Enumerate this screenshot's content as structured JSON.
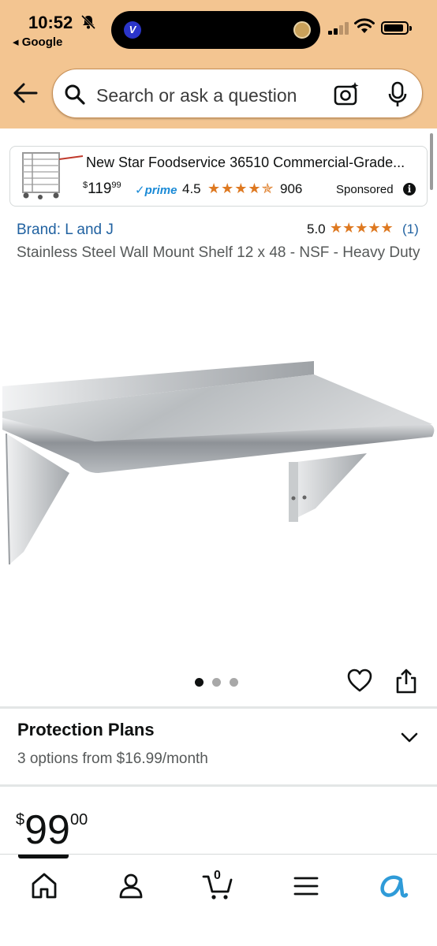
{
  "status_bar": {
    "time": "10:52",
    "back_app": "◂ Google"
  },
  "header": {
    "search_placeholder": "Search or ask a question"
  },
  "sponsored": {
    "title": "New Star Foodservice 36510 Commercial-Grade...",
    "price_symbol": "$",
    "price_whole": "119",
    "price_fraction": "99",
    "prime_label": "✓prime",
    "rating": "4.5",
    "stars": "★★★★✯",
    "review_count": "906",
    "sponsored_label": "Sponsored",
    "info_glyph": "i"
  },
  "product": {
    "brand": "Brand: L and J",
    "rating": "5.0",
    "stars": "★★★★★",
    "review_count": "(1)",
    "title": "Stainless Steel Wall Mount Shelf 12 x 48 - NSF - Heavy Duty",
    "image_count": 3,
    "active_image": 1
  },
  "protection_plans": {
    "title": "Protection Plans",
    "subtitle": "3 options from $16.99/month"
  },
  "price": {
    "symbol": "$",
    "whole": "99",
    "fraction": "00"
  },
  "bottom_nav": {
    "cart_count": "0",
    "items": [
      "home-icon",
      "profile-icon",
      "cart-icon",
      "menu-icon",
      "rufus-icon"
    ]
  },
  "colors": {
    "header_bg": "#f3c591",
    "link_blue": "#2162a1",
    "star_orange": "#de7921",
    "prime_blue": "#1a8ad6",
    "rufus_blue": "#2f9bd8"
  }
}
